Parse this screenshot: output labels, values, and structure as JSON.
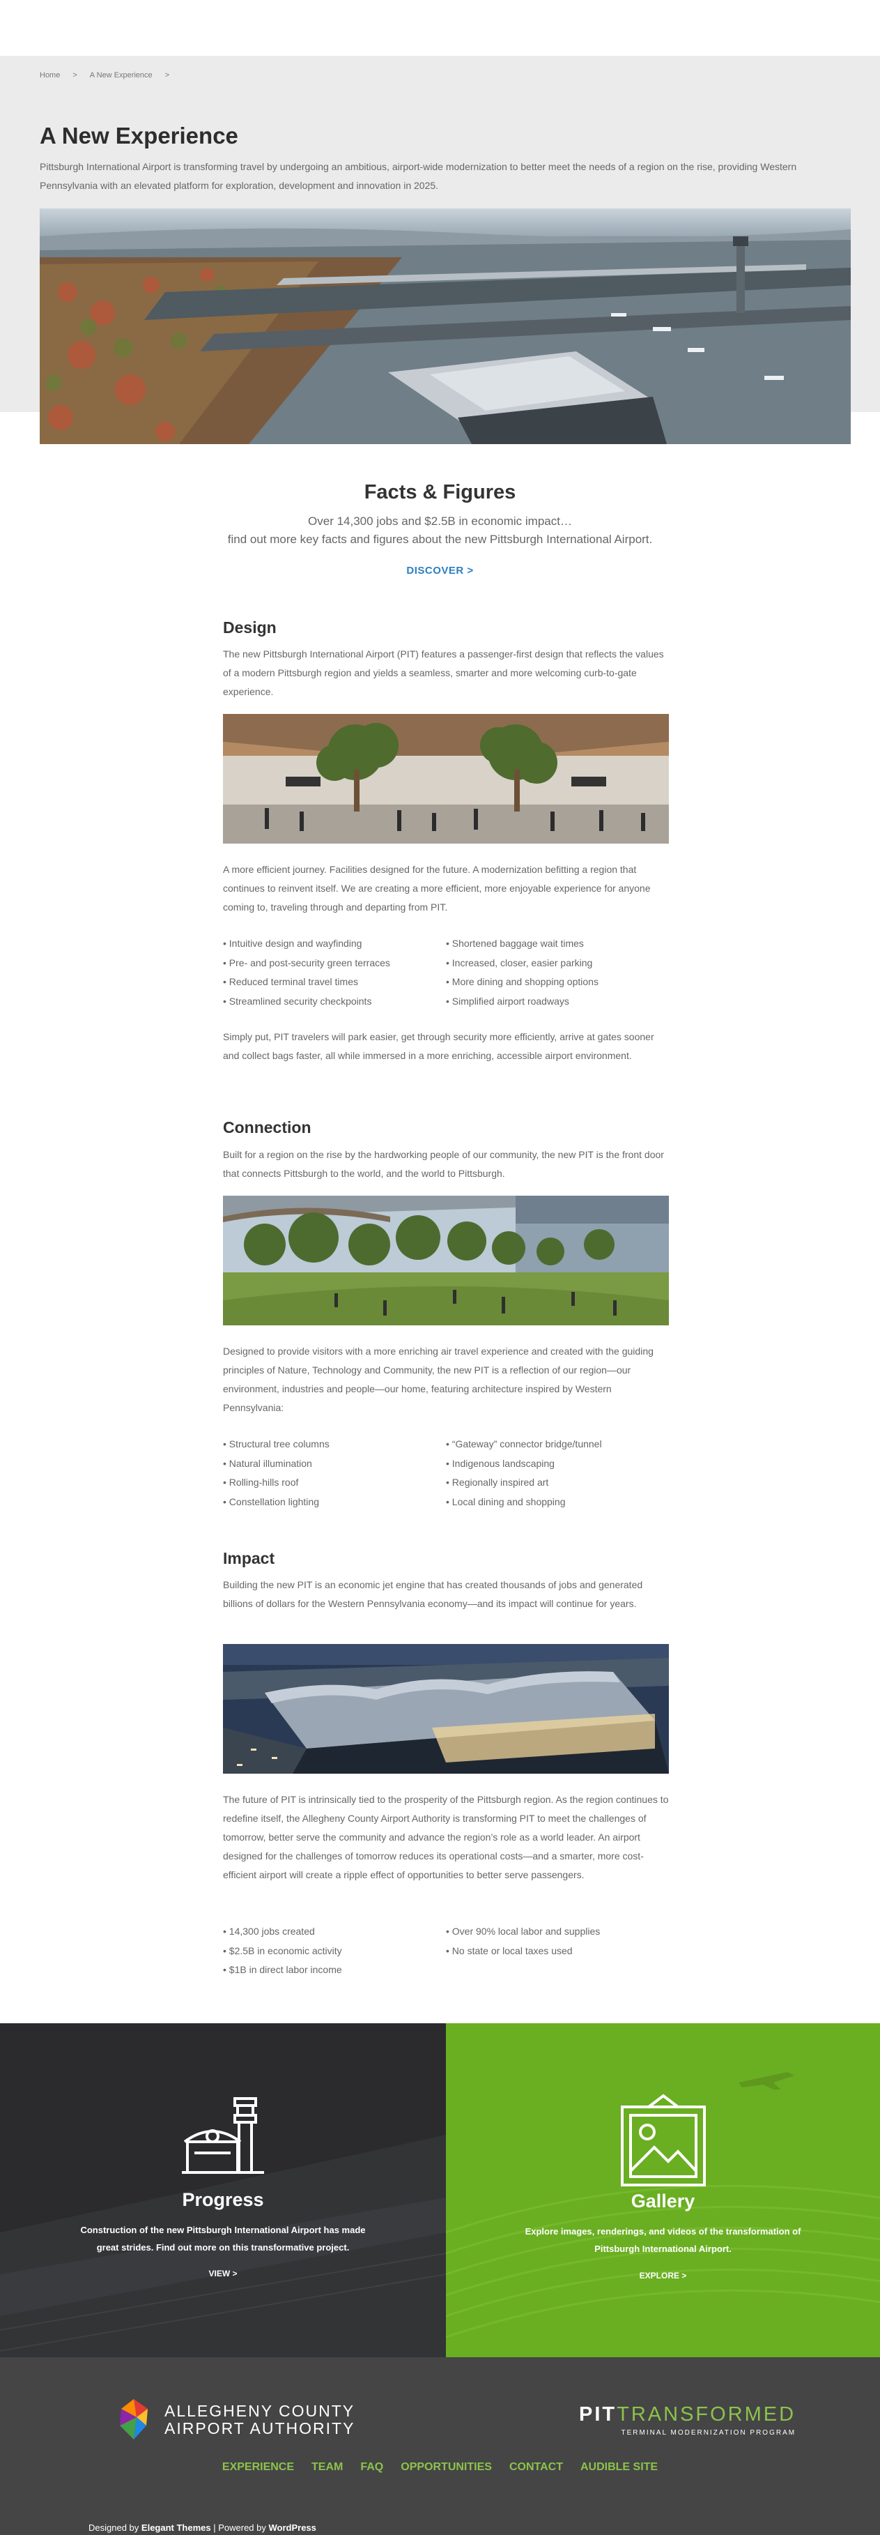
{
  "breadcrumb": {
    "home": "Home",
    "sep": ">",
    "current": "A New Experience",
    "trail_sep": ">"
  },
  "hero": {
    "title": "A New Experience",
    "intro": "Pittsburgh International Airport is transforming travel by undergoing an ambitious, airport-wide modernization to better meet the needs of a region on the rise, providing Western Pennsylvania with an elevated platform for exploration, development and innovation in 2025."
  },
  "facts": {
    "title": "Facts & Figures",
    "line1": "Over 14,300 jobs and $2.5B in economic impact…",
    "line2": "find out more key facts and figures about the new Pittsburgh International Airport.",
    "discover_label": "DISCOVER >"
  },
  "design": {
    "heading": "Design",
    "para1": "The new Pittsburgh International Airport (PIT) features a passenger-first design that reflects the values of a modern Pittsburgh region and yields a seamless, smarter and more welcoming curb-to-gate experience.",
    "para2": "A more efficient journey. Facilities designed for the future. A modernization befitting a region that continues to reinvent itself. We are creating a more efficient, more enjoyable experience for anyone coming to, traveling through and departing from PIT.",
    "list_left": [
      "• Intuitive design and wayfinding",
      "• Pre- and post-security green terraces",
      "• Reduced terminal travel times",
      "• Streamlined security checkpoints"
    ],
    "list_right": [
      "• Shortened baggage wait times",
      "• Increased, closer, easier parking",
      "• More dining and shopping options",
      "• Simplified airport roadways"
    ],
    "para3": "Simply put, PIT travelers will park easier, get through security more efficiently, arrive at gates sooner and collect bags faster, all while immersed in a more enriching, accessible airport environment."
  },
  "connection": {
    "heading": "Connection",
    "para1": "Built for a region on the rise by the hardworking people of our community, the new PIT is the front door that connects Pittsburgh to the world, and the world to Pittsburgh.",
    "para2": "Designed to provide visitors with a more enriching air travel experience and created with the guiding principles of Nature, Technology and Community, the new PIT is a reflection of our region—our environment, industries and people—our home, featuring architecture inspired by Western Pennsylvania:",
    "list_left": [
      "• Structural tree columns",
      "• Natural illumination",
      "• Rolling-hills roof",
      "• Constellation lighting"
    ],
    "list_right": [
      "• “Gateway” connector bridge/tunnel",
      "• Indigenous landscaping",
      "• Regionally inspired art",
      "• Local dining and shopping"
    ]
  },
  "impact": {
    "heading": "Impact",
    "para1": "Building the new PIT is an economic jet engine that has created thousands of jobs and generated billions of dollars for the Western Pennsylvania economy—and its impact will continue for years.",
    "para2": "The future of PIT is intrinsically tied to the prosperity of the Pittsburgh region. As the region continues to redefine itself, the Allegheny County Airport Authority is transforming PIT to meet the challenges of tomorrow, better serve the community and advance the region’s role as a world leader. An airport designed for the challenges of tomorrow reduces its operational costs—and a smarter, more cost-efficient airport will create a ripple effect of opportunities to better serve passengers.",
    "list_left": [
      "• 14,300 jobs created",
      "• $2.5B in economic activity",
      "• $1B in direct labor income"
    ],
    "list_right": [
      "• Over 90% local labor and supplies",
      "• No state or local taxes used"
    ]
  },
  "cards": {
    "progress": {
      "title": "Progress",
      "text": "Construction of the new Pittsburgh International Airport has made great strides. Find out more on this transformative project.",
      "link": "VIEW >"
    },
    "gallery": {
      "title": "Gallery",
      "text": "Explore images, renderings, and videos of the transformation of Pittsburgh International Airport.",
      "link": "EXPLORE >"
    }
  },
  "footer": {
    "acaa_line1": "ALLEGHENY COUNTY",
    "acaa_line2": "AIRPORT AUTHORITY",
    "pit_bold": "PIT",
    "pit_rest": "TRANSFORMED",
    "pit_sub": "TERMINAL MODERNIZATION PROGRAM",
    "nav": [
      "EXPERIENCE",
      "TEAM",
      "FAQ",
      "OPPORTUNITIES",
      "CONTACT",
      "AUDIBLE SITE"
    ],
    "credit_prefix": "Designed by",
    "credit_themes": "Elegant Themes",
    "credit_mid": "| Powered by",
    "credit_wp": "WordPress"
  },
  "colors": {
    "accent_blue": "#2c7fc4",
    "brand_green": "#8bc34a",
    "card_green": "#6aae22",
    "card_dark": "#2b2b2d",
    "footer_bg": "#454546"
  }
}
